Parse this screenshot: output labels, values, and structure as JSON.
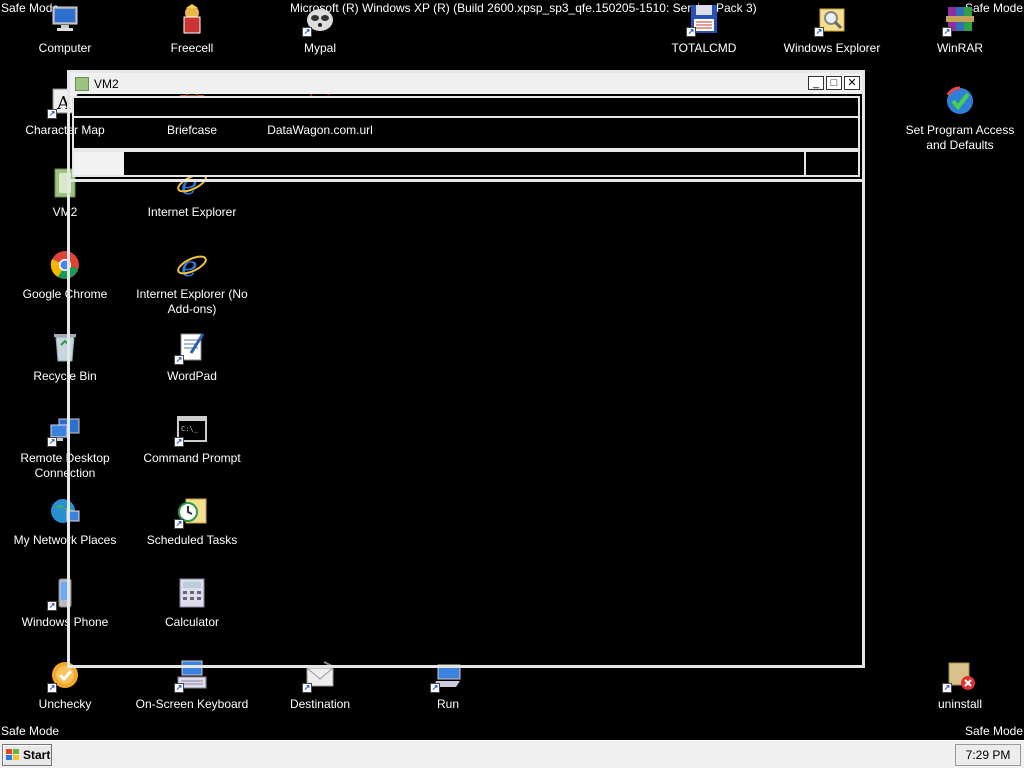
{
  "safe_mode": {
    "top_left": "Safe Mode",
    "top_right": "Safe Mode",
    "bottom_left": "Safe Mode",
    "bottom_right": "Safe Mode"
  },
  "build_text": "Microsoft (R) Windows XP (R) (Build 2600.xpsp_sp3_qfe.150205-1510: Service Pack 3)",
  "icons": {
    "computer": "Computer",
    "freecell": "Freecell",
    "mypal": "Mypal",
    "totalcmd": "TOTALCMD",
    "windows_explorer": "Windows Explorer",
    "winrar": "WinRAR",
    "character_map": "Character Map",
    "briefcase": "Briefcase",
    "datawagon": "DataWagon.com.url",
    "set_program_access": "Set Program Access and Defaults",
    "vm2": "VM2",
    "internet_explorer": "Internet Explorer",
    "google_chrome": "Google Chrome",
    "ie_no_addons": "Internet Explorer (No Add-ons)",
    "recycle_bin": "Recycle Bin",
    "wordpad": "WordPad",
    "remote_desktop": "Remote Desktop Connection",
    "command_prompt": "Command Prompt",
    "my_network_places": "My Network Places",
    "scheduled_tasks": "Scheduled Tasks",
    "windows_phone": "Windows Phone",
    "calculator": "Calculator",
    "unchecky": "Unchecky",
    "onscreen_keyboard": "On-Screen Keyboard",
    "destination": "Destination",
    "run": "Run",
    "uninstall": "uninstall"
  },
  "window": {
    "title": "VM2",
    "minimize_glyph": "_",
    "maximize_glyph": "□",
    "close_glyph": "✕"
  },
  "taskbar": {
    "start_label": "Start",
    "clock": "7:29 PM"
  },
  "colors": {
    "desktop": "#000000",
    "window_frame": "#e6e6e6",
    "taskbar": "#f0f0f0"
  }
}
